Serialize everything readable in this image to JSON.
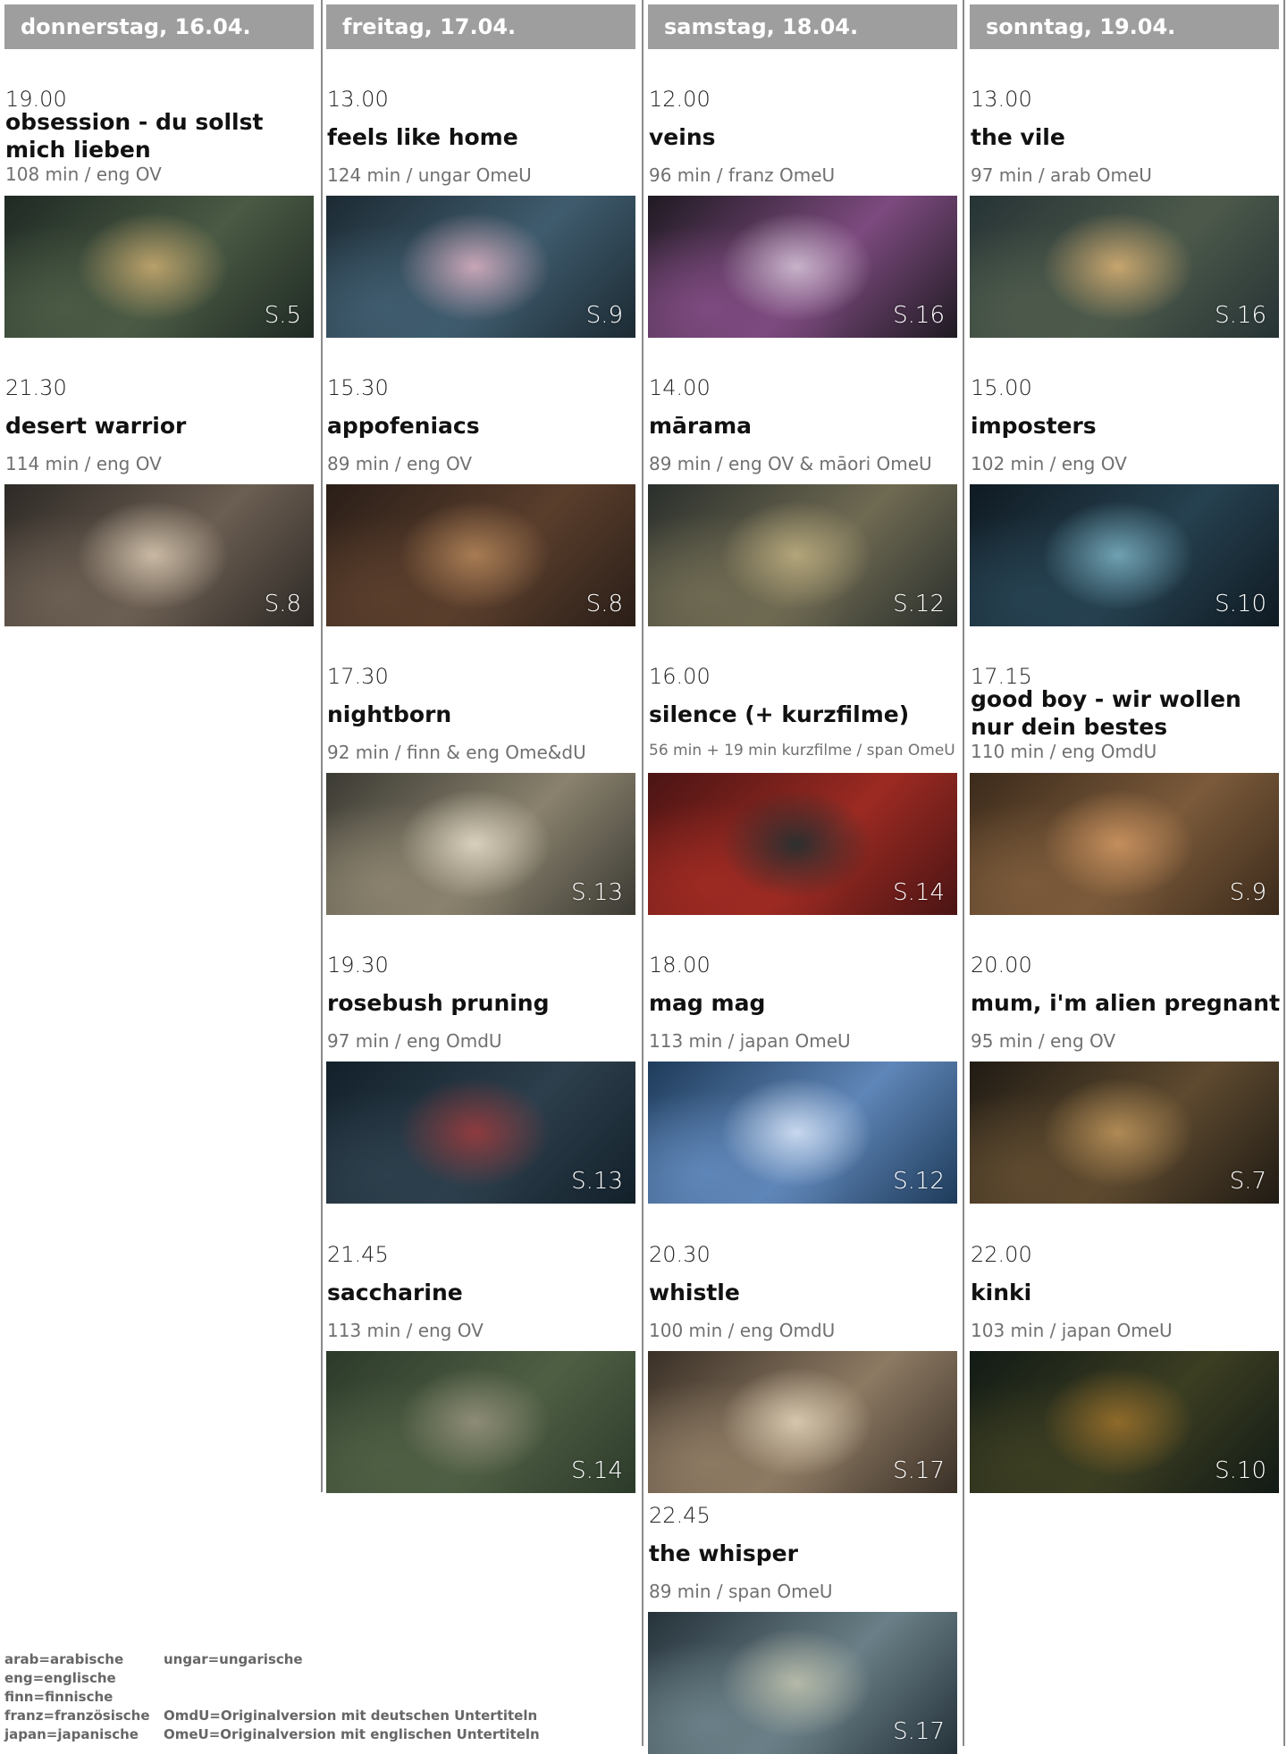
{
  "days": [
    {
      "header": "donnerstag, 16.04.",
      "films": [
        {
          "time": "19.00",
          "title": "obsession - du sollst mich lieben",
          "meta": "108 min / eng OV",
          "room": "S.5"
        },
        {
          "time": "21.30",
          "title": "desert warrior",
          "meta": "114 min / eng OV",
          "room": "S.8"
        }
      ]
    },
    {
      "header": "freitag, 17.04.",
      "films": [
        {
          "time": "13.00",
          "title": "feels like home",
          "meta": "124 min / ungar OmeU",
          "room": "S.9"
        },
        {
          "time": "15.30",
          "title": "appofeniacs",
          "meta": "89 min / eng OV",
          "room": "S.8"
        },
        {
          "time": "17.30",
          "title": "nightborn",
          "meta": "92 min / finn & eng Ome&dU",
          "room": "S.13"
        },
        {
          "time": "19.30",
          "title": "rosebush pruning",
          "meta": "97 min / eng OmdU",
          "room": "S.13"
        },
        {
          "time": "21.45",
          "title": "saccharine",
          "meta": "113 min / eng OV",
          "room": "S.14"
        }
      ]
    },
    {
      "header": "samstag, 18.04.",
      "films": [
        {
          "time": "12.00",
          "title": "veins",
          "meta": "96 min / franz OmeU",
          "room": "S.16"
        },
        {
          "time": "14.00",
          "title": "mārama",
          "meta": "89 min / eng OV & māori OmeU",
          "room": "S.12"
        },
        {
          "time": "16.00",
          "title": "silence (+ kurzfilme)",
          "meta": "56 min + 19 min kurzfilme / span OmeU",
          "room": "S.14"
        },
        {
          "time": "18.00",
          "title": "mag mag",
          "meta": "113 min / japan OmeU",
          "room": "S.12"
        },
        {
          "time": "20.30",
          "title": "whistle",
          "meta": "100 min / eng OmdU",
          "room": "S.17"
        },
        {
          "time": "22.45",
          "title": "the whisper",
          "meta": "89 min / span OmeU",
          "room": "S.17"
        }
      ]
    },
    {
      "header": "sonntag, 19.04.",
      "films": [
        {
          "time": "13.00",
          "title": "the vile",
          "meta": "97 min / arab OmeU",
          "room": "S.16"
        },
        {
          "time": "15.00",
          "title": "imposters",
          "meta": "102 min / eng OV",
          "room": "S.10"
        },
        {
          "time": "17.15",
          "title": "good boy - wir wollen nur dein bestes",
          "meta": "110 min / eng OmdU",
          "room": "S.9"
        },
        {
          "time": "20.00",
          "title": "mum, i'm alien pregnant",
          "meta": "95 min / eng OV",
          "room": "S.7"
        },
        {
          "time": "22.00",
          "title": "kinki",
          "meta": "103 min / japan OmeU",
          "room": "S.10"
        }
      ]
    }
  ],
  "legend": {
    "languages": [
      "arab=arabische",
      "eng=englische",
      "finn=finnische",
      "franz=französische",
      "japan=japanische"
    ],
    "languages2": [
      "ungar=ungarische"
    ],
    "subtitles": [
      "OmdU=Originalversion mit deutschen Untertiteln",
      "OmeU=Originalversion mit englischen Untertiteln"
    ]
  }
}
